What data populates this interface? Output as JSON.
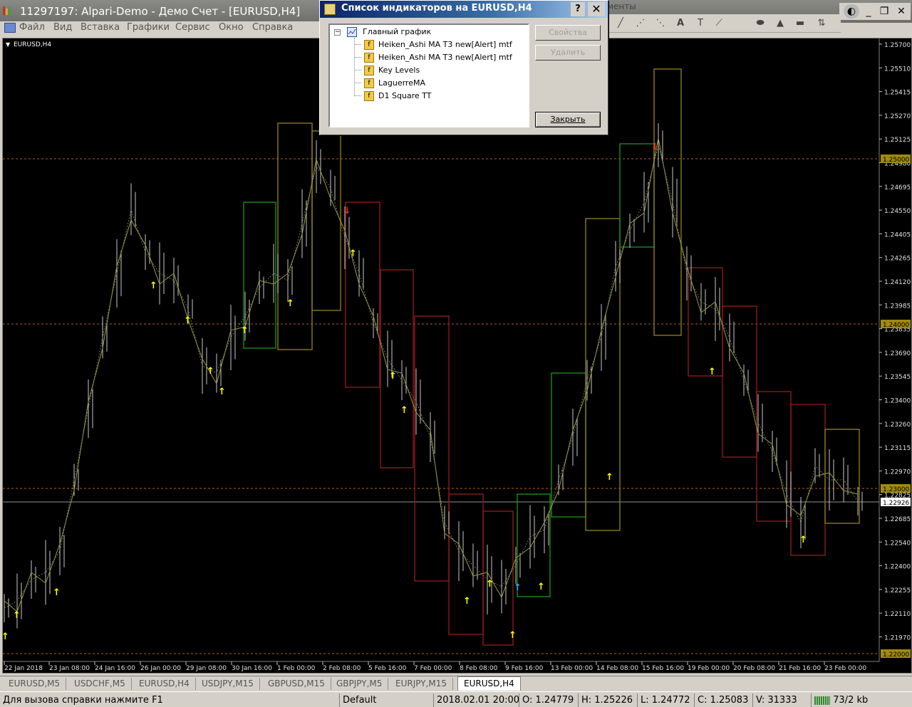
{
  "window": {
    "title": "11297197: Alpari-Demo - Демо Счет - [EURUSD,H4]"
  },
  "menu": [
    "Файл",
    "Вид",
    "Вставка",
    "Графики",
    "Сервис",
    "Окно",
    "Справка"
  ],
  "toolbar": {
    "title_fragment": "менты",
    "tools": [
      "trendline-icon",
      "fibo-icon",
      "fibo-fan-icon",
      "text-icon",
      "label-icon",
      "ellipse-icon",
      "triangle-icon",
      "rectangle-icon",
      "arrows-icon"
    ]
  },
  "chart": {
    "symbol_label": "EURUSD,H4",
    "price_labels": [
      "1.25700",
      "1.25510",
      "1.25415",
      "1.25270",
      "1.25125",
      "1.24980",
      "1.24695",
      "1.24550",
      "1.24405",
      "1.24265",
      "1.24120",
      "1.23985",
      "1.23835",
      "1.23690",
      "1.23545",
      "1.23400",
      "1.23260",
      "1.23115",
      "1.22970",
      "1.22825",
      "1.22685",
      "1.22540",
      "1.22400",
      "1.22255",
      "1.22110",
      "1.21970"
    ],
    "level_badges": [
      "1.25000",
      "1.24000",
      "1.23000",
      "1.22000"
    ],
    "current_price": "1.22926",
    "date_labels": [
      "22 Jan 2018",
      "23 Jan 08:00",
      "24 Jan 16:00",
      "26 Jan 00:00",
      "29 Jan 08:00",
      "30 Jan 16:00",
      "1 Feb 00:00",
      "2 Feb 08:00",
      "5 Feb 16:00",
      "7 Feb 00:00",
      "8 Feb 08:00",
      "9 Feb 16:00",
      "13 Feb 00:00",
      "14 Feb 08:00",
      "15 Feb 16:00",
      "19 Feb 00:00",
      "20 Feb 08:00",
      "21 Feb 16:00",
      "23 Feb 00:00"
    ],
    "colors": {
      "background": "#000000",
      "bars": "#c8c8c8",
      "bull_box": "#1a8a1a",
      "bear_box": "#8b1a1a",
      "neutral_box": "#8a7a1a",
      "arrow_up": "#ffff00",
      "arrow_down": "#ff2020",
      "arrow_blue": "#20b0ff",
      "level_line": "#b06020",
      "ma_line": "#9a9a40"
    }
  },
  "dialog": {
    "title": "Список индикаторов на EURUSD,H4",
    "help_label": "?",
    "close_label": "✕",
    "tree_root": "Главный график",
    "indicators": [
      "Heiken_Ashi MA T3 new[Alert] mtf",
      "Heiken_Ashi MA T3 new[Alert] mtf",
      "Key Levels",
      "LaguerreMA",
      "D1 Square TT"
    ],
    "buttons": {
      "properties": "Свойства",
      "delete": "Удалить",
      "close": "Закрыть"
    }
  },
  "tabs": [
    "EURUSD,M5",
    "USDCHF,M5",
    "EURUSD,H4",
    "USDJPY,M15",
    "GBPUSD,M15",
    "GBPJPY,M5",
    "EURJPY,M15",
    "EURUSD,H4"
  ],
  "active_tab_index": 7,
  "status": {
    "help": "Для вызова справки нажмите F1",
    "profile": "Default",
    "datetime": "2018.02.01 20:00",
    "open": "O: 1.24779",
    "high": "H: 1.25226",
    "low": "L: 1.24772",
    "close": "C: 1.25083",
    "volume": "V: 31333",
    "traffic": "73/2 kb"
  }
}
